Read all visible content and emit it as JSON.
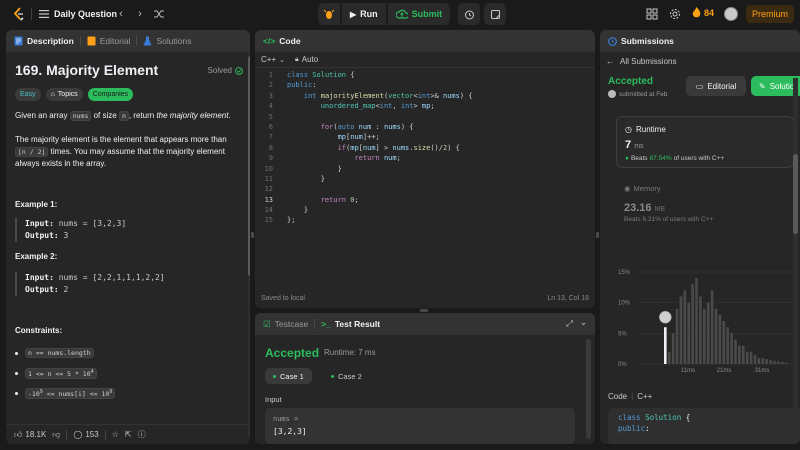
{
  "nav": {
    "title": "Daily Question",
    "run": "Run",
    "submit": "Submit",
    "streak": "84",
    "premium": "Premium"
  },
  "desc": {
    "tabs": [
      "Description",
      "Editorial",
      "Solutions"
    ],
    "title": "169. Majority Element",
    "solved": "Solved",
    "tags": [
      "Easy",
      "Topics",
      "Companies"
    ],
    "p1_a": "Given an array ",
    "p1_code": "nums",
    "p1_b": " of size ",
    "p1_code2": "n",
    "p1_c": ", return ",
    "p1_em": "the majority element",
    "p1_d": ".",
    "p2_a": "The majority element is the element that appears more than",
    "p2_code": "⌊n / 2⌋",
    "p2_b": " times. You may assume that the majority element",
    "p2_c": "always exists in the array.",
    "ex1_h": "Example 1:",
    "ex1_in_lbl": "Input:",
    "ex1_in": " nums = [3,2,3]",
    "ex1_out_lbl": "Output:",
    "ex1_out": " 3",
    "ex2_h": "Example 2:",
    "ex2_in_lbl": "Input:",
    "ex2_in": " nums = [2,2,1,1,1,2,2]",
    "ex2_out_lbl": "Output:",
    "ex2_out": " 2",
    "constraints_h": "Constraints:",
    "c1": "n == nums.length",
    "c2": "1 <= n <= 5 * 10",
    "c2_sup": "4",
    "c3_a": "-10",
    "c3_sup1": "9",
    "c3_b": " <= nums[i] <= 10",
    "c3_sup2": "9",
    "likes": "18.1K",
    "comments": "153"
  },
  "code": {
    "title": "Code",
    "lang": "C++",
    "auto": "Auto",
    "saved": "Saved to local",
    "position": "Ln 13, Col 18"
  },
  "test": {
    "tabs": [
      "Testcase",
      "Test Result"
    ],
    "accepted": "Accepted",
    "runtime": "Runtime: 7 ms",
    "cases": [
      "Case 1",
      "Case 2"
    ],
    "input_label": "Input",
    "var_name": "nums =",
    "var_value": "[3,2,3]"
  },
  "subs": {
    "title": "Submissions",
    "back": "All Submissions",
    "accepted": "Accepted",
    "submitted": "submitted at Feb",
    "editorial": "Editorial",
    "solution": "Solution",
    "runtime_h": "Runtime",
    "runtime_v": "7",
    "runtime_u": "ms",
    "beats_a": "Beats",
    "beats_pct": "87.54%",
    "beats_b": "of users with C++",
    "memory_h": "Memory",
    "memory_v": "23.16",
    "memory_u": "MB",
    "mem_beats_a": "Beats",
    "mem_beats_pct": "6.31%",
    "mem_beats_b": "of users with C++",
    "code_h": "Code",
    "code_lang": "C++"
  },
  "chart_data": {
    "type": "bar",
    "yticks": [
      "15%",
      "10%",
      "5%",
      "0%"
    ],
    "xticks": [
      "11ms",
      "21ms",
      "31ms"
    ],
    "ylim": [
      0,
      15
    ],
    "highlight_index": 0,
    "values": [
      6,
      2,
      5,
      9,
      11,
      12,
      10,
      13,
      14,
      11,
      9,
      10,
      12,
      9,
      8,
      7,
      6,
      5,
      4,
      3,
      3,
      2,
      2,
      1.5,
      1,
      1,
      0.8,
      0.6,
      0.5,
      0.4,
      0.3,
      0.2
    ]
  }
}
